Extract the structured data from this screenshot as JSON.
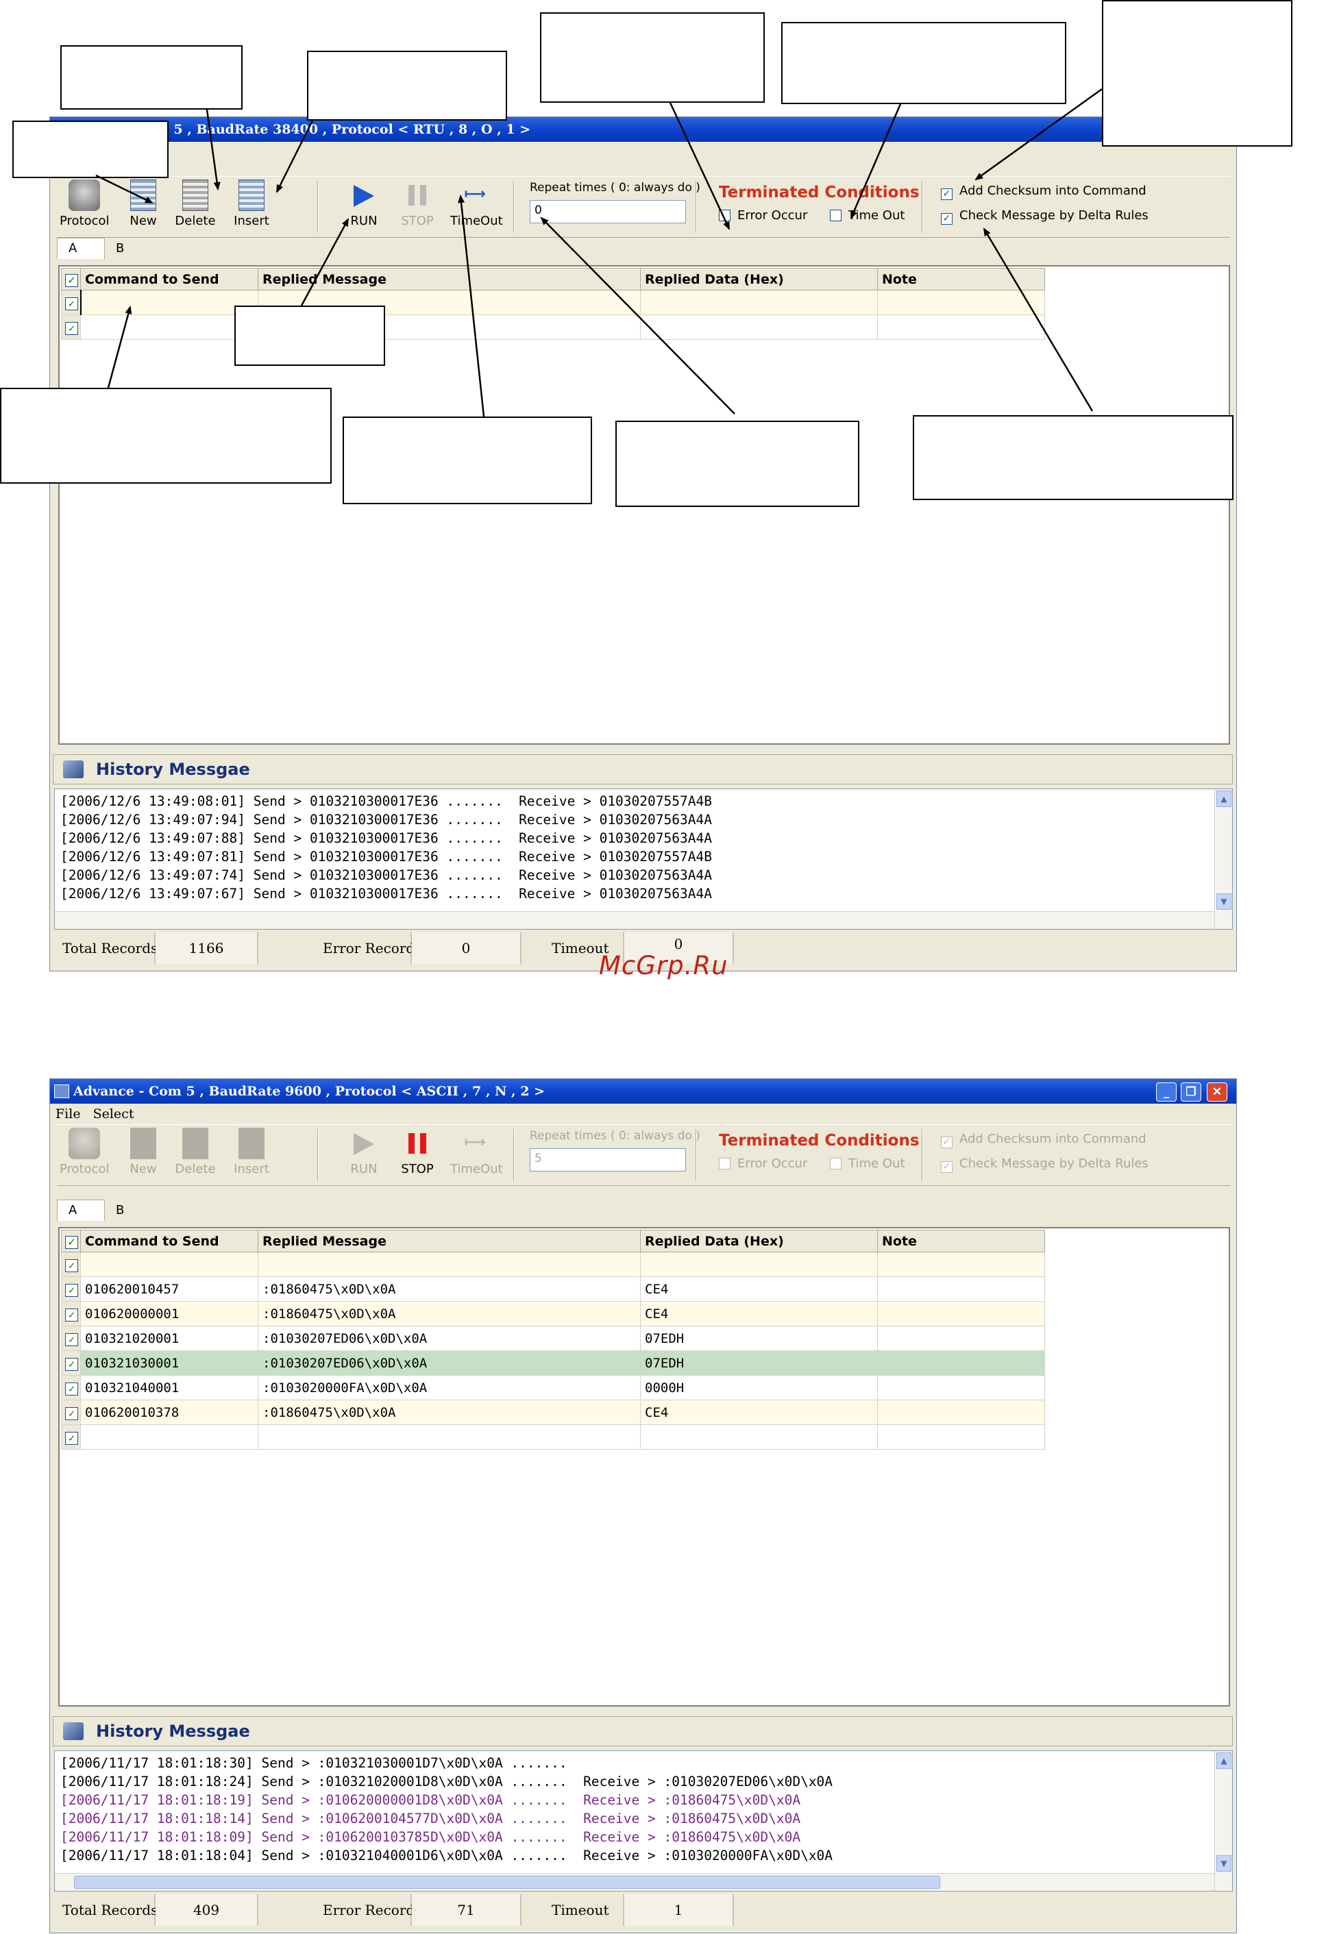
{
  "watermark": "McGrp.Ru",
  "window1": {
    "title": "n 5 , BaudRate 38400 , Protocol < RTU , 8 , O , 1 >",
    "toolbar": {
      "protocol": "Protocol",
      "new": "New",
      "delete": "Delete",
      "insert": "Insert",
      "run": "RUN",
      "stop": "STOP",
      "timeout": "TimeOut",
      "repeat_label": "Repeat times ( 0: always do )",
      "repeat_value": "0",
      "terminated_title": "Terminated Conditions",
      "error_occur": "Error Occur",
      "time_out": "Time Out",
      "add_checksum": "Add Checksum into Command",
      "check_message": "Check Message by Delta Rules"
    },
    "tabs": [
      "A",
      "B"
    ],
    "columns": [
      "Command to Send",
      "Replied Message",
      "Replied Data (Hex)",
      "Note"
    ],
    "history_title": "History Messgae",
    "history": [
      "[2006/12/6 13:49:08:01] Send > 0103210300017E36 .......  Receive > 01030207557A4B",
      "[2006/12/6 13:49:07:94] Send > 0103210300017E36 .......  Receive > 01030207563A4A",
      "[2006/12/6 13:49:07:88] Send > 0103210300017E36 .......  Receive > 01030207563A4A",
      "[2006/12/6 13:49:07:81] Send > 0103210300017E36 .......  Receive > 01030207557A4B",
      "[2006/12/6 13:49:07:74] Send > 0103210300017E36 .......  Receive > 01030207563A4A",
      "[2006/12/6 13:49:07:67] Send > 0103210300017E36 .......  Receive > 01030207563A4A"
    ],
    "status": {
      "total_label": "Total Records",
      "total_value": "1166",
      "error_label": "Error Records",
      "error_value": "0",
      "timeout_label": "Timeout",
      "timeout_value": "0"
    }
  },
  "window2": {
    "title": "Advance - Com 5 , BaudRate 9600 , Protocol < ASCII , 7 , N , 2 >",
    "menu": [
      "File",
      "Select"
    ],
    "toolbar": {
      "protocol": "Protocol",
      "new": "New",
      "delete": "Delete",
      "insert": "Insert",
      "run": "RUN",
      "stop": "STOP",
      "timeout": "TimeOut",
      "repeat_label": "Repeat times ( 0: always do )",
      "repeat_value": "5",
      "terminated_title": "Terminated Conditions",
      "error_occur": "Error Occur",
      "time_out": "Time Out",
      "add_checksum": "Add Checksum into Command",
      "check_message": "Check Message by Delta Rules"
    },
    "tabs": [
      "A",
      "B"
    ],
    "columns": [
      "Command to Send",
      "Replied Message",
      "Replied Data (Hex)",
      "Note"
    ],
    "rows": [
      {
        "cmd": "",
        "msg": "",
        "hex": "",
        "note": ""
      },
      {
        "cmd": "010620010457",
        "msg": ":01860475\\x0D\\x0A",
        "hex": "CE4",
        "note": ""
      },
      {
        "cmd": "010620000001",
        "msg": ":01860475\\x0D\\x0A",
        "hex": "CE4",
        "note": ""
      },
      {
        "cmd": "010321020001",
        "msg": ":01030207ED06\\x0D\\x0A",
        "hex": "07EDH",
        "note": ""
      },
      {
        "cmd": "010321030001",
        "msg": ":01030207ED06\\x0D\\x0A",
        "hex": "07EDH",
        "note": ""
      },
      {
        "cmd": "010321040001",
        "msg": ":0103020000FA\\x0D\\x0A",
        "hex": "0000H",
        "note": ""
      },
      {
        "cmd": "010620010378",
        "msg": ":01860475\\x0D\\x0A",
        "hex": "CE4",
        "note": ""
      },
      {
        "cmd": "",
        "msg": "",
        "hex": "",
        "note": ""
      }
    ],
    "history_title": "History Messgae",
    "history": [
      "[2006/11/17 18:01:18:30] Send > :010321030001D7\\x0D\\x0A .......",
      "[2006/11/17 18:01:18:24] Send > :010321020001D8\\x0D\\x0A .......  Receive > :01030207ED06\\x0D\\x0A",
      "[2006/11/17 18:01:18:19] Send > :010620000001D8\\x0D\\x0A .......  Receive > :01860475\\x0D\\x0A",
      "[2006/11/17 18:01:18:14] Send > :0106200104577D\\x0D\\x0A .......  Receive > :01860475\\x0D\\x0A",
      "[2006/11/17 18:01:18:09] Send > :0106200103785D\\x0D\\x0A .......  Receive > :01860475\\x0D\\x0A",
      "[2006/11/17 18:01:18:04] Send > :010321040001D6\\x0D\\x0A .......  Receive > :0103020000FA\\x0D\\x0A"
    ],
    "status": {
      "total_label": "Total Records",
      "total_value": "409",
      "error_label": "Error Records",
      "error_value": "71",
      "timeout_label": "Timeout",
      "timeout_value": "1"
    }
  }
}
